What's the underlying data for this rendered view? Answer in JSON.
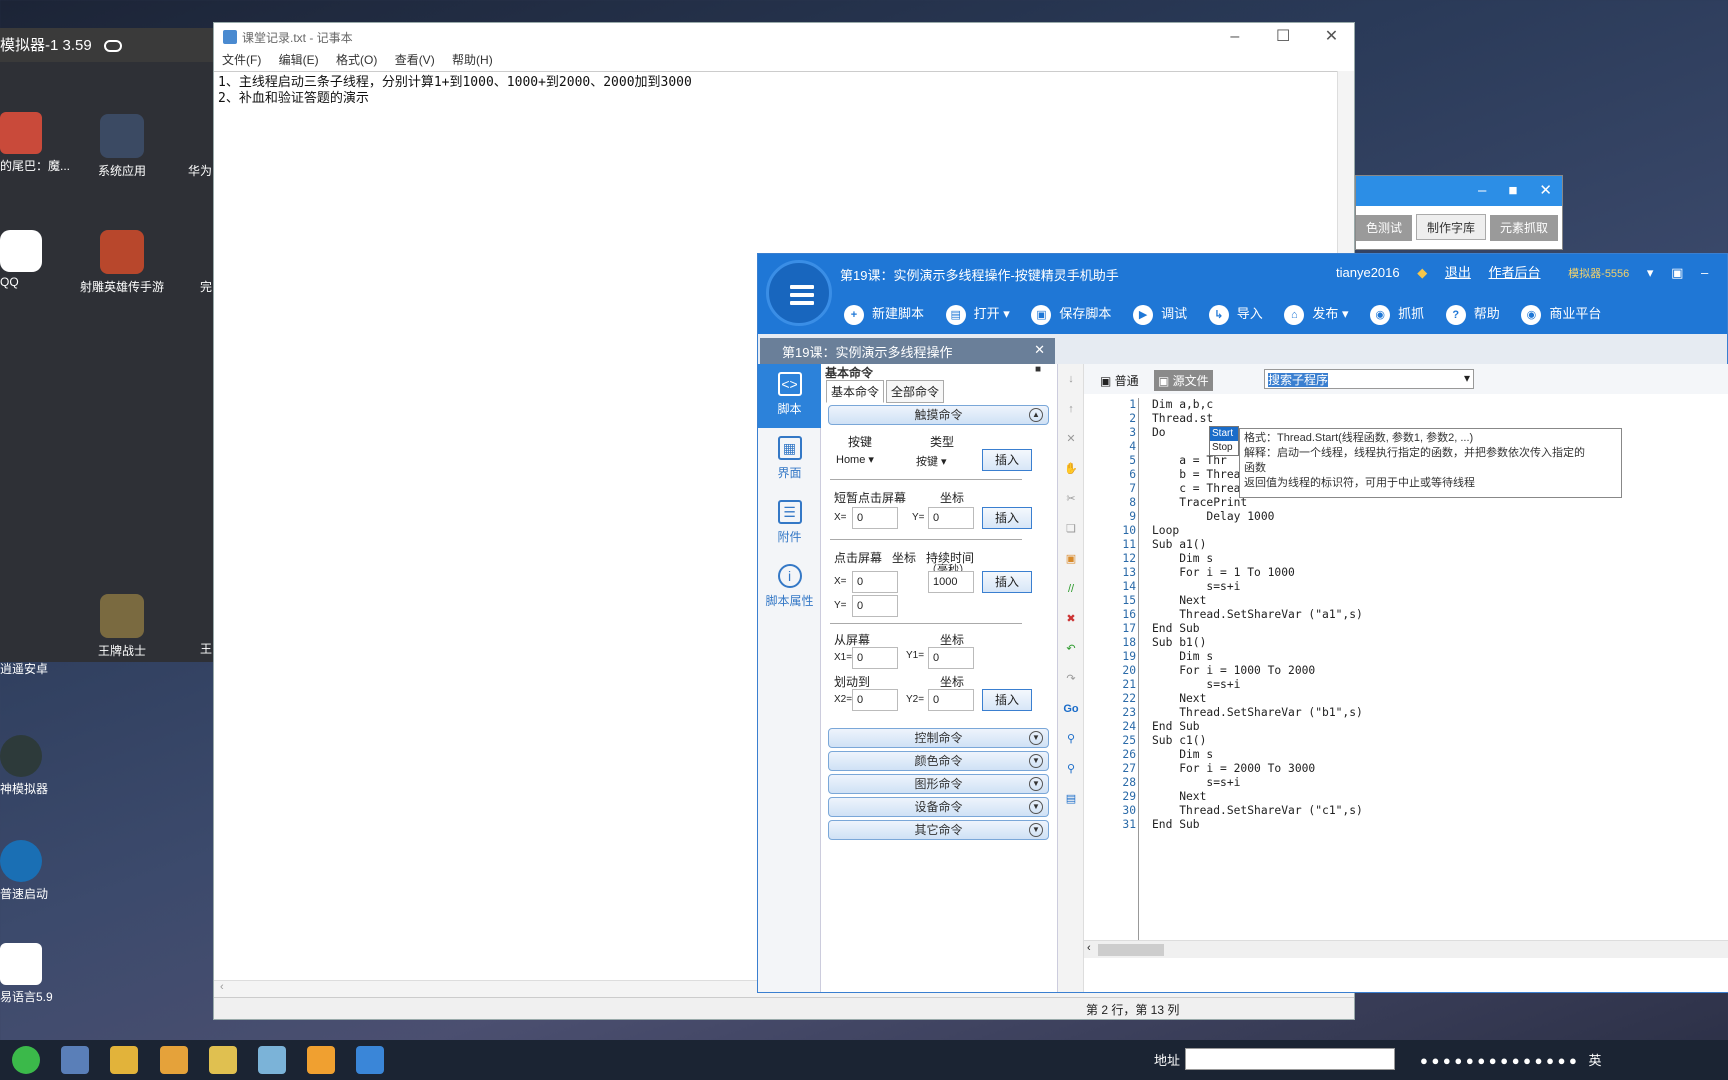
{
  "desktop": {
    "emulator_title": "模拟器-1 3.59",
    "icons_left": [
      {
        "label": "的尾巴：魔..."
      },
      {
        "label": "QQ"
      },
      {
        "label": "逍遥安卓"
      },
      {
        "label": "神模拟器"
      },
      {
        "label": "普速启动"
      },
      {
        "label": "易语言5.9"
      }
    ],
    "icons_mid": [
      {
        "label": "系统应用"
      },
      {
        "label": "射雕英雄传手游"
      },
      {
        "label": "王牌战士"
      }
    ],
    "icons_partial": [
      {
        "label": "华为"
      },
      {
        "label": "完"
      },
      {
        "label": "王"
      }
    ]
  },
  "notepad": {
    "title": "课堂记录.txt - 记事本",
    "menu": [
      "文件(F)",
      "编辑(E)",
      "格式(O)",
      "查看(V)",
      "帮助(H)"
    ],
    "lines": [
      "1、主线程启动三条子线程，分别计算1+到1000、1000+到2000、2000加到3000",
      "2、补血和验证答题的演示"
    ],
    "status": "第 2 行，第 13 列"
  },
  "small_window": {
    "tabs": [
      "色测试",
      "制作字库",
      "元素抓取"
    ]
  },
  "app": {
    "title": "第19课：实例演示多线程操作-按键精灵手机助手",
    "user": "tianye2016",
    "links": [
      "退出",
      "作者后台"
    ],
    "device": "模拟器-5556",
    "toolbar": [
      {
        "label": "新建脚本"
      },
      {
        "label": "打开"
      },
      {
        "label": "保存脚本"
      },
      {
        "label": "调试"
      },
      {
        "label": "导入"
      },
      {
        "label": "发布"
      },
      {
        "label": "抓抓"
      },
      {
        "label": "帮助"
      },
      {
        "label": "商业平台"
      }
    ],
    "doc_tab": "第19课：实例演示多线程操作",
    "nav": [
      {
        "label": "脚本"
      },
      {
        "label": "界面"
      },
      {
        "label": "附件"
      },
      {
        "label": "脚本属性"
      }
    ],
    "cmd": {
      "header": "基本命令",
      "tabs": [
        "基本命令",
        "全部命令"
      ],
      "touch_section": "触摸命令",
      "key_label": "按键",
      "type_label": "类型",
      "key_value": "Home",
      "type_value": "按键",
      "insert": "插入",
      "short_click": "短暂点击屏幕",
      "coord": "坐标",
      "x_eq": "X=",
      "y_eq": "Y=",
      "x1_eq": "X1=",
      "y1_eq": "Y1=",
      "x2_eq": "X2=",
      "y2_eq": "Y2=",
      "zero": "0",
      "click_screen": "点击屏幕",
      "duration": "持续时间",
      "ms": "（毫秒）",
      "duration_value": "1000",
      "from_screen": "从屏幕",
      "swipe_to": "划动到",
      "sections": [
        "控制命令",
        "颜色命令",
        "图形命令",
        "设备命令",
        "其它命令"
      ]
    },
    "editor": {
      "mode_normal": "普通",
      "mode_source": "源文件",
      "search_sub": "搜索子程序",
      "line_count": 31,
      "code": [
        "Dim a,b,c",
        "Thread.st",
        "Do",
        "",
        "    a = Thr",
        "    b = Threa",
        "    c = Threa",
        "    TracePrint",
        "        Delay 1000",
        "Loop",
        "Sub a1()",
        "    Dim s",
        "    For i = 1 To 1000",
        "        s=s+i",
        "    Next",
        "    Thread.SetShareVar (\"a1\",s)",
        "End Sub",
        "Sub b1()",
        "    Dim s",
        "    For i = 1000 To 2000",
        "        s=s+i",
        "    Next",
        "    Thread.SetShareVar (\"b1\",s)",
        "End Sub",
        "Sub c1()",
        "    Dim s",
        "    For i = 2000 To 3000",
        "        s=s+i",
        "    Next",
        "    Thread.SetShareVar (\"c1\",s)",
        "End Sub"
      ],
      "autocomplete": [
        "Start",
        "Stop"
      ],
      "tooltip": [
        "格式：Thread.Start(线程函数, 参数1, 参数2, ...)",
        "解释：启动一个线程，线程执行指定的函数，并把参数依次传入指定的",
        "函数",
        "返回值为线程的标识符，可用于中止或等待线程"
      ]
    }
  },
  "taskbar": {
    "address_label": "地址",
    "ime": "英"
  }
}
